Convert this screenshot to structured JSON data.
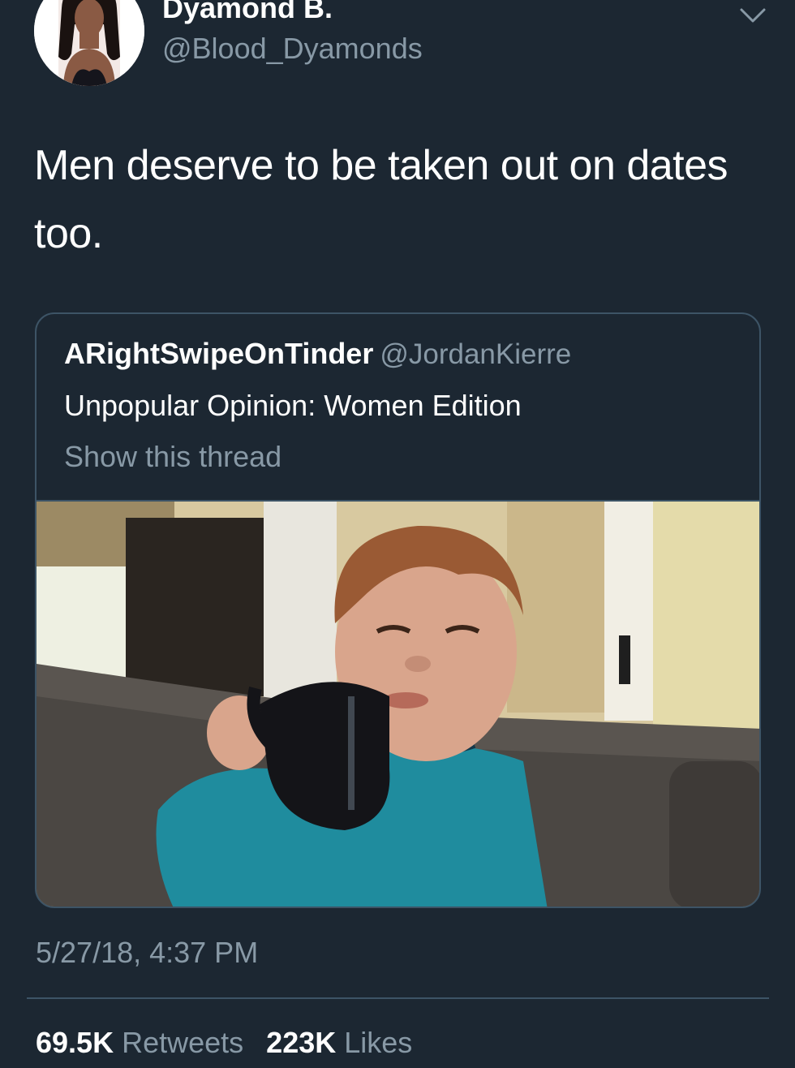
{
  "author": {
    "display_name": "Dyamond B.",
    "handle": "@Blood_Dyamonds",
    "avatar_icon": "profile-photo"
  },
  "tweet": {
    "text": "Men deserve to be taken out on dates too."
  },
  "quoted_tweet": {
    "display_name": "ARightSwipeOnTinder",
    "handle": "@JordanKierre",
    "text": "Unpopular Opinion: Women Edition",
    "show_thread_label": "Show this thread",
    "media_icon": "photo-boy-drinking-from-black-mug"
  },
  "timestamp": "5/27/18, 4:37 PM",
  "stats": {
    "retweets_count": "69.5K",
    "retweets_label": "Retweets",
    "likes_count": "223K",
    "likes_label": "Likes"
  },
  "colors": {
    "background": "#1c2732",
    "primary_text": "#ffffff",
    "secondary_text": "#8899a6",
    "border": "#3d5466"
  }
}
